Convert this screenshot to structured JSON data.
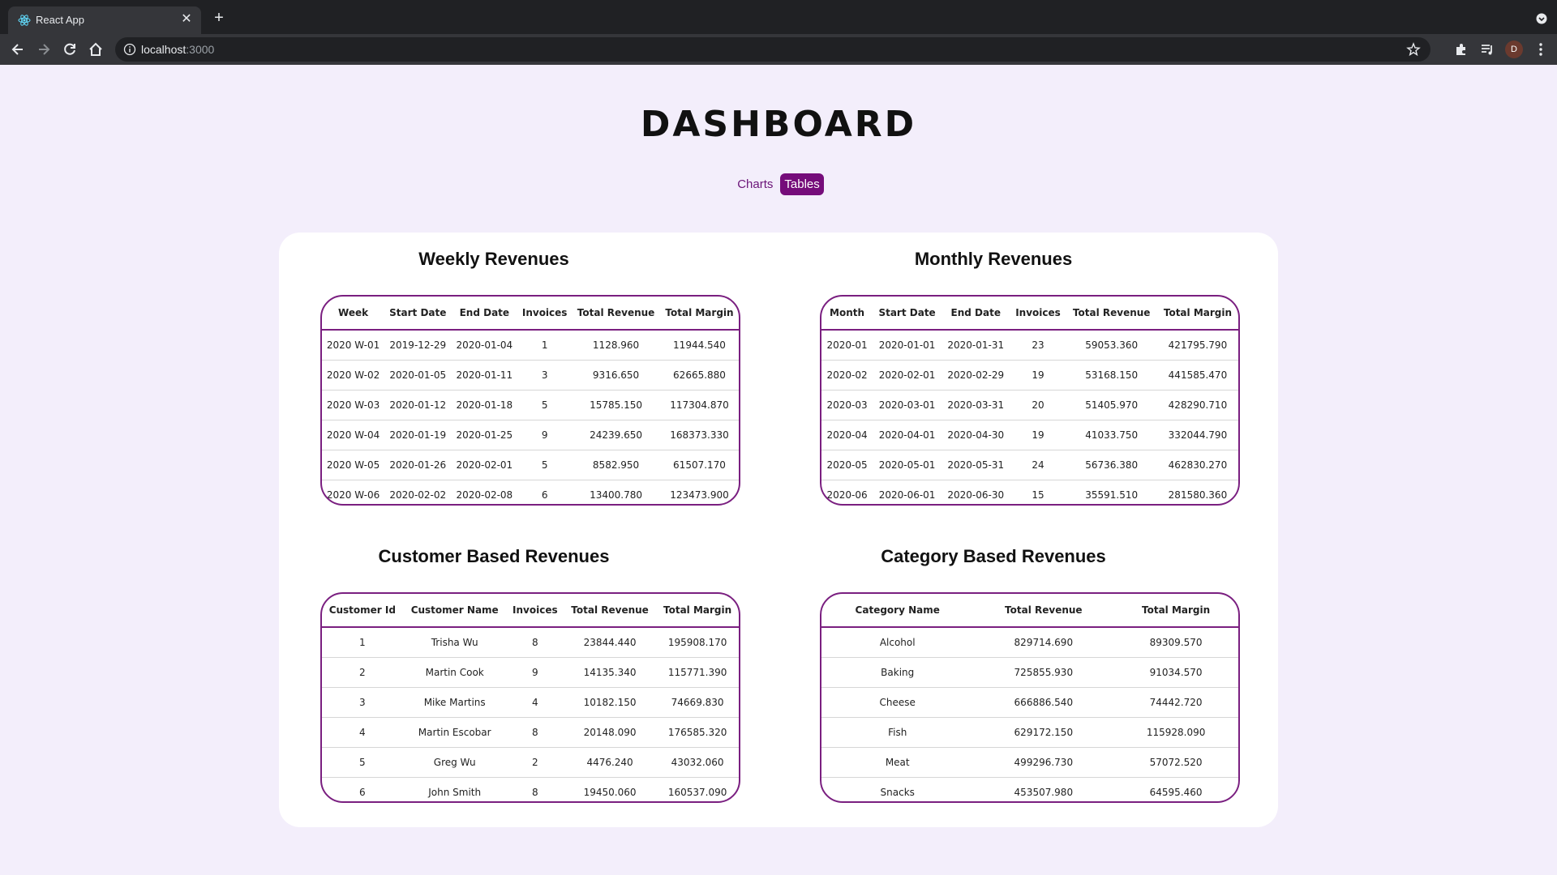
{
  "browser": {
    "tab_title": "React App",
    "url_host": "localhost",
    "url_port": ":3000",
    "profile_initial": "D"
  },
  "page": {
    "title": "DASHBOARD",
    "nav": [
      {
        "label": "Charts",
        "active": false
      },
      {
        "label": "Tables",
        "active": true
      }
    ]
  },
  "colors": {
    "accent": "#750c7a",
    "page_bg": "#f3eefb",
    "card_bg": "#ffffff"
  },
  "weekly": {
    "title": "Weekly Revenues",
    "columns": [
      "Week",
      "Start Date",
      "End Date",
      "Invoices",
      "Total Revenue",
      "Total Margin"
    ],
    "rows": [
      [
        "2020 W-01",
        "2019-12-29",
        "2020-01-04",
        "1",
        "1128.960",
        "11944.540"
      ],
      [
        "2020 W-02",
        "2020-01-05",
        "2020-01-11",
        "3",
        "9316.650",
        "62665.880"
      ],
      [
        "2020 W-03",
        "2020-01-12",
        "2020-01-18",
        "5",
        "15785.150",
        "117304.870"
      ],
      [
        "2020 W-04",
        "2020-01-19",
        "2020-01-25",
        "9",
        "24239.650",
        "168373.330"
      ],
      [
        "2020 W-05",
        "2020-01-26",
        "2020-02-01",
        "5",
        "8582.950",
        "61507.170"
      ],
      [
        "2020 W-06",
        "2020-02-02",
        "2020-02-08",
        "6",
        "13400.780",
        "123473.900"
      ]
    ]
  },
  "monthly": {
    "title": "Monthly Revenues",
    "columns": [
      "Month",
      "Start Date",
      "End Date",
      "Invoices",
      "Total Revenue",
      "Total Margin"
    ],
    "rows": [
      [
        "2020-01",
        "2020-01-01",
        "2020-01-31",
        "23",
        "59053.360",
        "421795.790"
      ],
      [
        "2020-02",
        "2020-02-01",
        "2020-02-29",
        "19",
        "53168.150",
        "441585.470"
      ],
      [
        "2020-03",
        "2020-03-01",
        "2020-03-31",
        "20",
        "51405.970",
        "428290.710"
      ],
      [
        "2020-04",
        "2020-04-01",
        "2020-04-30",
        "19",
        "41033.750",
        "332044.790"
      ],
      [
        "2020-05",
        "2020-05-01",
        "2020-05-31",
        "24",
        "56736.380",
        "462830.270"
      ],
      [
        "2020-06",
        "2020-06-01",
        "2020-06-30",
        "15",
        "35591.510",
        "281580.360"
      ]
    ]
  },
  "customer": {
    "title": "Customer Based Revenues",
    "columns": [
      "Customer Id",
      "Customer Name",
      "Invoices",
      "Total Revenue",
      "Total Margin"
    ],
    "rows": [
      [
        "1",
        "Trisha Wu",
        "8",
        "23844.440",
        "195908.170"
      ],
      [
        "2",
        "Martin Cook",
        "9",
        "14135.340",
        "115771.390"
      ],
      [
        "3",
        "Mike Martins",
        "4",
        "10182.150",
        "74669.830"
      ],
      [
        "4",
        "Martin Escobar",
        "8",
        "20148.090",
        "176585.320"
      ],
      [
        "5",
        "Greg Wu",
        "2",
        "4476.240",
        "43032.060"
      ],
      [
        "6",
        "John Smith",
        "8",
        "19450.060",
        "160537.090"
      ]
    ]
  },
  "category": {
    "title": "Category Based Revenues",
    "columns": [
      "Category Name",
      "Total Revenue",
      "Total Margin"
    ],
    "rows": [
      [
        "Alcohol",
        "829714.690",
        "89309.570"
      ],
      [
        "Baking",
        "725855.930",
        "91034.570"
      ],
      [
        "Cheese",
        "666886.540",
        "74442.720"
      ],
      [
        "Fish",
        "629172.150",
        "115928.090"
      ],
      [
        "Meat",
        "499296.730",
        "57072.520"
      ],
      [
        "Snacks",
        "453507.980",
        "64595.460"
      ]
    ]
  }
}
